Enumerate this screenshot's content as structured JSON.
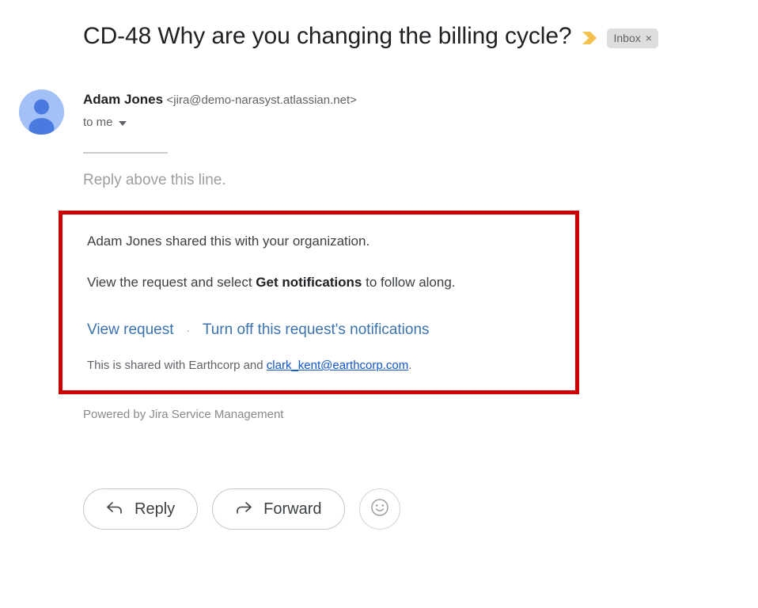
{
  "subject": {
    "text": "CD-48 Why are you changing the billing cycle?",
    "important_marker_icon": "important-marker-icon",
    "important_marker_color": "#f2c14e",
    "label_chip": {
      "name": "Inbox",
      "remove": "×"
    }
  },
  "sender": {
    "avatar_icon": "person-avatar-icon",
    "name": "Adam Jones",
    "email": "<jira@demo-narasyst.atlassian.net>",
    "recipient": "to me",
    "expand_icon": "chevron-down-icon"
  },
  "body": {
    "divider": "—–—–—–—–—",
    "reply_above": "Reply above this line.",
    "shared_sentence": "Adam Jones shared this with your organization.",
    "view_request_prefix": "View the request and select ",
    "view_request_bold": "Get notifications",
    "view_request_suffix": " to follow along.",
    "link_view_request": "View request",
    "link_separator": "·",
    "link_turn_off": "Turn off this request's notifications",
    "shared_with_prefix": "This is shared with Earthcorp and ",
    "shared_with_email": "clark_kent@earthcorp.com",
    "shared_with_suffix": ".",
    "powered_by": "Powered by Jira Service Management",
    "highlight_color": "#cc0000"
  },
  "actions": {
    "reply_label": "Reply",
    "reply_icon": "reply-arrow-icon",
    "forward_label": "Forward",
    "forward_icon": "forward-arrow-icon",
    "emoji_icon": "smiley-face-icon"
  }
}
